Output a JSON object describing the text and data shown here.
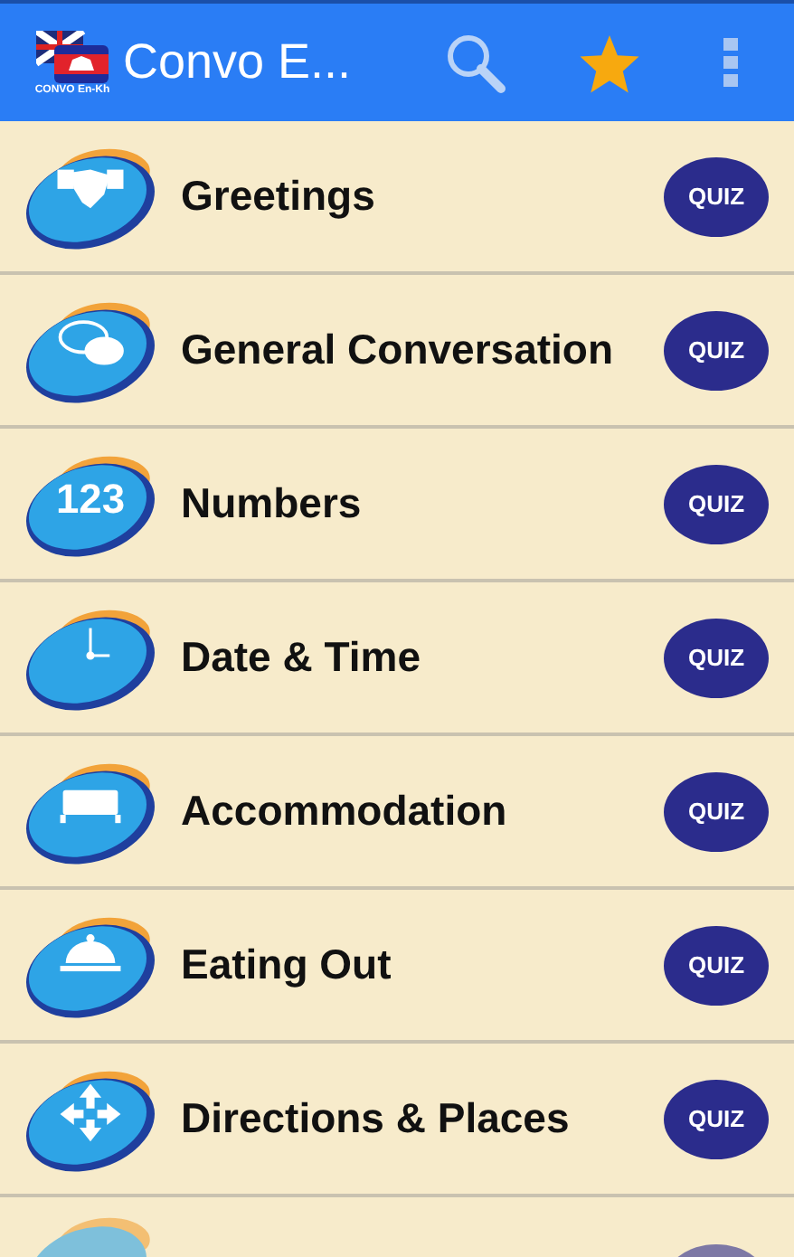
{
  "app_bar": {
    "logo_caption": "CONVO En-Kh",
    "title": "Convo E..."
  },
  "categories": [
    {
      "label": "Greetings",
      "quiz": "QUIZ"
    },
    {
      "label": "General Conversation",
      "quiz": "QUIZ"
    },
    {
      "label": "Numbers",
      "icon_text": "123",
      "quiz": "QUIZ"
    },
    {
      "label": "Date & Time",
      "quiz": "QUIZ"
    },
    {
      "label": "Accommodation",
      "quiz": "QUIZ"
    },
    {
      "label": "Eating Out",
      "quiz": "QUIZ"
    },
    {
      "label": "Directions & Places",
      "quiz": "QUIZ"
    }
  ]
}
